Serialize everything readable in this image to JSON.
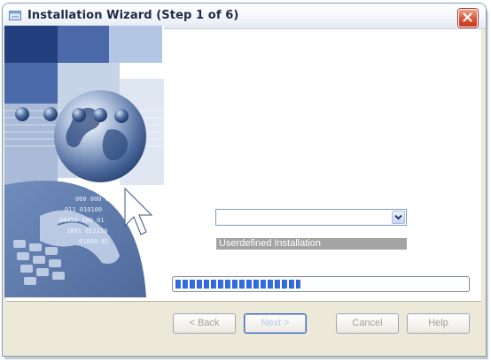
{
  "window": {
    "title": "Installation Wizard (Step 1 of 6)"
  },
  "sidebar": {
    "binary_texts": [
      "01000 001",
      "000 000 00",
      "011 010100",
      "00050 100 01",
      "1001 011110",
      "01000 01"
    ]
  },
  "install_type": {
    "select_value": "",
    "label": "Userdefined Installation"
  },
  "progress": {
    "value": 0.43
  },
  "buttons": {
    "back_label": "< Back",
    "next_label": "Next >",
    "cancel_label": "Cancel",
    "help_label": "Help"
  },
  "colors": {
    "accent": "#2d63d9",
    "close_red": "#d9533a"
  },
  "icons": [
    "installer-icon",
    "close-icon",
    "chevron-down-icon"
  ]
}
